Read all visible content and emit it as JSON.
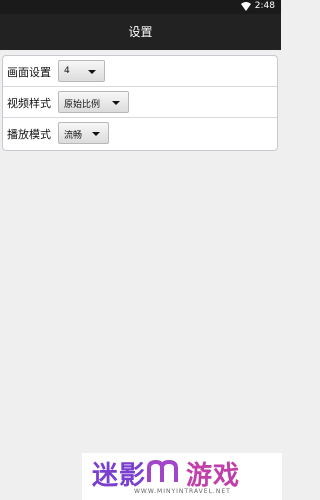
{
  "status_bar": {
    "time": "2:48",
    "wifi_icon": "wifi-icon"
  },
  "title": "设置",
  "settings": [
    {
      "label": "画面设置",
      "value": "4"
    },
    {
      "label": "视频样式",
      "value": "原始比例"
    },
    {
      "label": "播放模式",
      "value": "流畅"
    }
  ],
  "watermark": {
    "text_part1": "迷影",
    "text_part2": "游戏",
    "url": "WWW.MINYINTRAVEL.NET"
  }
}
